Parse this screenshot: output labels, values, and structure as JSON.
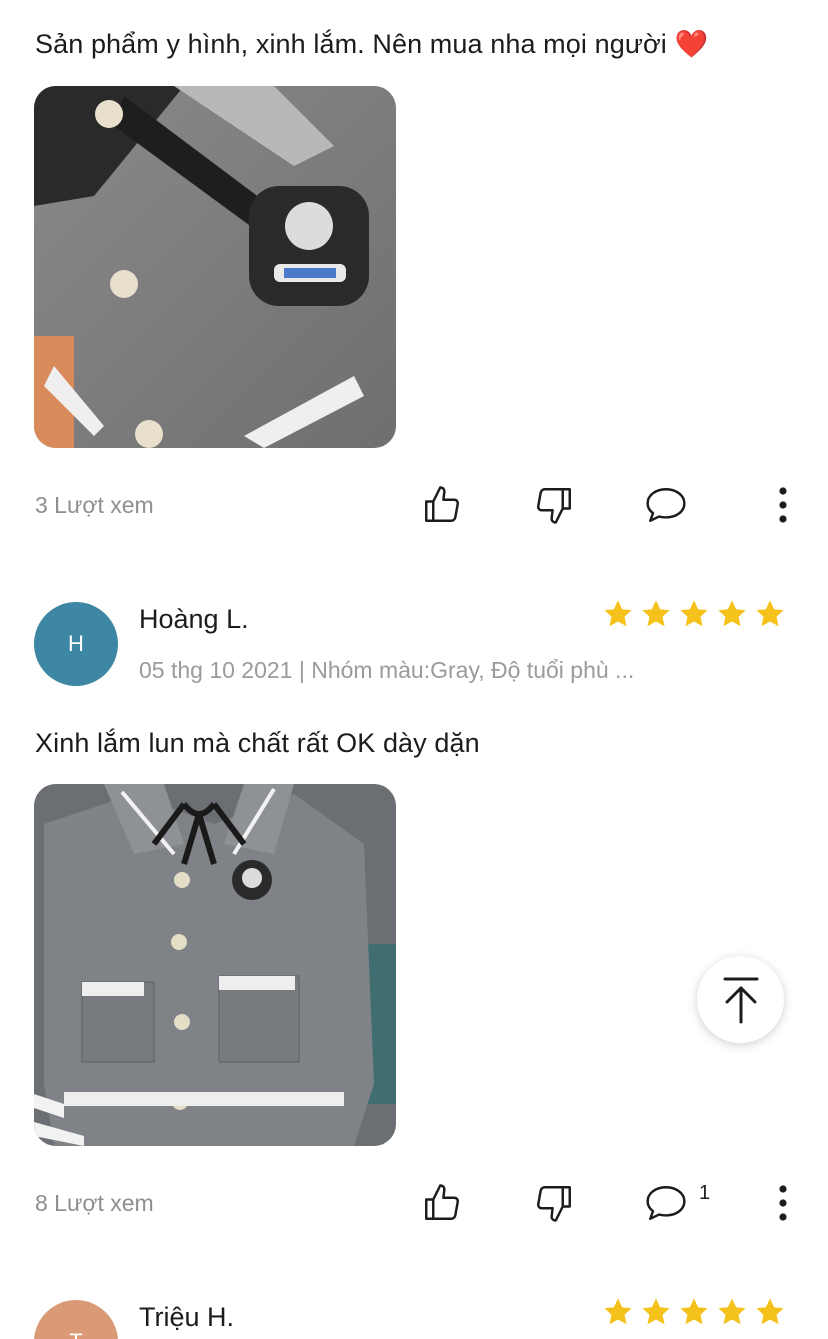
{
  "reviews": [
    {
      "text": "Sản phẩm y hình, xinh lắm. Nên mua nha mọi người ❤️",
      "views": "3 Lượt xem",
      "comment_count": ""
    },
    {
      "avatar_letter": "H",
      "avatar_color": "#3d86a4",
      "name": "Hoàng L.",
      "meta": "05 thg 10 2021 | Nhóm màu:Gray, Độ tuổi phù ...",
      "rating": 5,
      "text": "Xinh lắm lun mà chất rất OK dày dặn",
      "views": "8 Lượt xem",
      "comment_count": "1"
    },
    {
      "avatar_letter": "T",
      "avatar_color": "#d99a75",
      "name": "Triệu H.",
      "rating": 5
    }
  ],
  "icons": {
    "like": "thumbs-up-icon",
    "dislike": "thumbs-down-icon",
    "comment": "comment-icon",
    "more": "more-vertical-icon",
    "scroll_top": "arrow-up-to-top-icon",
    "star_color": "#f5c21b"
  }
}
